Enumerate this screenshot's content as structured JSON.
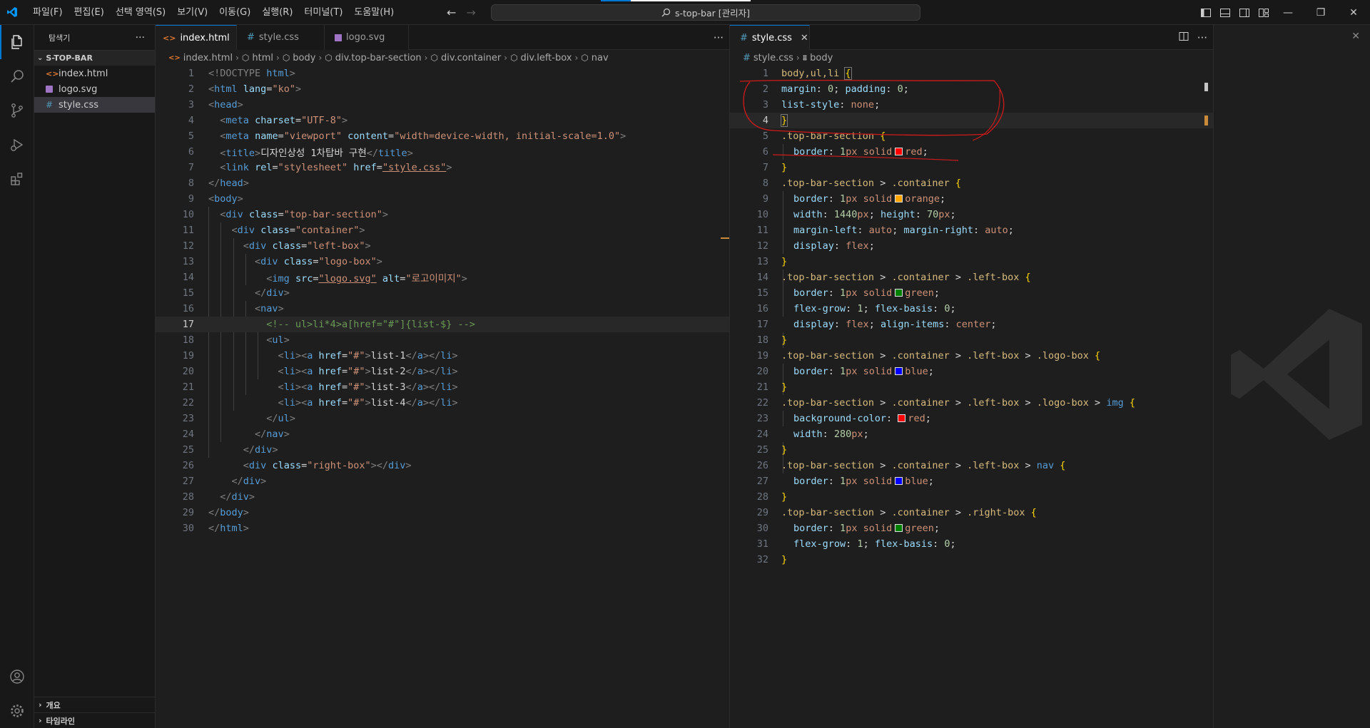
{
  "window": {
    "menu": [
      "파일(F)",
      "편집(E)",
      "선택 영역(S)",
      "보기(V)",
      "이동(G)",
      "실행(R)",
      "터미널(T)",
      "도움말(H)"
    ],
    "search_text": "s-top-bar [관리자]",
    "controls": [
      "—",
      "❐",
      "✕"
    ]
  },
  "sidebar": {
    "title": "탐색기",
    "more": "···",
    "folder": "S-TOP-BAR",
    "files": [
      {
        "name": "index.html",
        "type": "html"
      },
      {
        "name": "logo.svg",
        "type": "svg"
      },
      {
        "name": "style.css",
        "type": "css",
        "selected": true
      }
    ],
    "panels": [
      "개요",
      "타임라인"
    ]
  },
  "left_editor": {
    "tabs": [
      {
        "label": "index.html",
        "active": true,
        "close": "✕"
      },
      {
        "label": "style.css",
        "active": false
      },
      {
        "label": "logo.svg",
        "active": false
      }
    ],
    "breadcrumb": [
      "index.html",
      "html",
      "body",
      "div.top-bar-section",
      "div.container",
      "div.left-box",
      "nav"
    ],
    "line_numbers": [
      "1",
      "2",
      "3",
      "4",
      "5",
      "6",
      "7",
      "8",
      "9",
      "10",
      "11",
      "12",
      "13",
      "14",
      "15",
      "16",
      "17",
      "18",
      "19",
      "20",
      "21",
      "22",
      "23",
      "24",
      "25",
      "26",
      "27",
      "28",
      "29",
      "30"
    ],
    "code": {
      "l1a": "<!DOCTYPE ",
      "l1b": "html",
      "l1c": ">",
      "l2_tag": "html",
      "l2_attr": "lang",
      "l2_val": "\"ko\"",
      "l3_tag": "head",
      "l4_tag": "meta",
      "l4_attr": "charset",
      "l4_val": "\"UTF-8\"",
      "l5_tag": "meta",
      "l5_attr1": "name",
      "l5_val1": "\"viewport\"",
      "l5_attr2": "content",
      "l5_val2": "\"width=device-width, initial-scale=1.0\"",
      "l6_tag": "title",
      "l6_text": "디자인상성 1차탑바 구현",
      "l7_tag": "link",
      "l7_attr1": "rel",
      "l7_val1": "\"stylesheet\"",
      "l7_attr2": "href",
      "l7_val2": "\"style.css\"",
      "l8_tag": "head",
      "l9_tag": "body",
      "l10_tag": "div",
      "l10_attr": "class",
      "l10_val": "\"top-bar-section\"",
      "l11_tag": "div",
      "l11_attr": "class",
      "l11_val": "\"container\"",
      "l12_tag": "div",
      "l12_attr": "class",
      "l12_val": "\"left-box\"",
      "l13_tag": "div",
      "l13_attr": "class",
      "l13_val": "\"logo-box\"",
      "l14_tag": "img",
      "l14_attr1": "src",
      "l14_val1": "\"logo.svg\"",
      "l14_attr2": "alt",
      "l14_val2": "\"로고이미지\"",
      "l15_tag": "div",
      "l16_tag": "nav",
      "l17_comment": "<!-- ul>li*4>a[href=\"#\"]{list-$} -->",
      "l18_tag": "ul",
      "li_tag": "li",
      "a_tag": "a",
      "href_attr": "href",
      "href_val": "\"#\"",
      "l19_text": "list-1",
      "l20_text": "list-2",
      "l21_text": "list-3",
      "l22_text": "list-4",
      "l23_tag": "ul",
      "l24_tag": "nav",
      "l25_tag": "div",
      "l26_tag": "div",
      "l26_attr": "class",
      "l26_val": "\"right-box\"",
      "l27_tag": "div",
      "l28_tag": "div",
      "l29_tag": "body",
      "l30_tag": "html"
    }
  },
  "right_editor": {
    "tab": {
      "label": "style.css",
      "close": "✕"
    },
    "breadcrumb": [
      "style.css",
      "body"
    ],
    "line_numbers": [
      "1",
      "2",
      "3",
      "4",
      "5",
      "6",
      "7",
      "8",
      "9",
      "10",
      "11",
      "12",
      "13",
      "14",
      "15",
      "16",
      "17",
      "18",
      "19",
      "20",
      "21",
      "22",
      "23",
      "24",
      "25",
      "26",
      "27",
      "28",
      "29",
      "30",
      "31",
      "32"
    ],
    "css": {
      "l1": "body,ul,li",
      "margin": "margin",
      "padding": "padding",
      "zero": "0",
      "list_style": "list-style",
      "none": "none",
      "sec": ".top-bar-section",
      "container": ".container",
      "left_box": ".left-box",
      "logo_box": ".logo-box",
      "img": "img",
      "nav": "nav",
      "right_box": ".right-box",
      "border": "border",
      "onepx": "1",
      "px": "px",
      "solid": "solid",
      "red": "red",
      "orange": "orange",
      "green": "green",
      "blue": "blue",
      "width": "width",
      "w1440": "1440",
      "height": "height",
      "h70": "70",
      "margin_left": "margin-left",
      "margin_right": "margin-right",
      "auto": "auto",
      "display": "display",
      "flex": "flex",
      "flex_grow": "flex-grow",
      "one": "1",
      "flex_basis": "flex-basis",
      "align_items": "align-items",
      "center": "center",
      "bg_color": "background-color",
      "w280": "280"
    },
    "colors": {
      "red": "#ff0000",
      "orange": "#ffa500",
      "green": "#008000",
      "blue": "#0000ff"
    }
  }
}
